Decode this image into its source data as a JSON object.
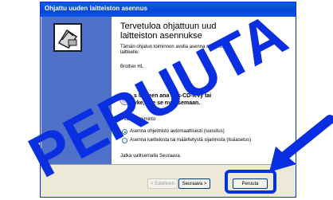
{
  "window": {
    "title": "Ohjattu uuden laitteiston asennus"
  },
  "wizard": {
    "heading_line1": "Tervetuloa ohjattuun uud",
    "heading_line2": "laitteiston asennukse",
    "intro_line1": "Tämän ohjatun toiminnon avulla asenna   ohjelmisto",
    "intro_line2": "laitteelle:",
    "device": "Brother HL",
    "cd_line1": "s laitteen    ana        nus-CD-levy tai",
    "cd_line2": "yke, ase    se nyt asemaan.",
    "question": "Valitse toiminto",
    "options": [
      {
        "label": "Asenna ohjelmisto automaattisesti (suositus)",
        "selected": true
      },
      {
        "label": "Asenna luettelosta tai määritetystä sijainnista (lisäasetus)",
        "selected": false
      }
    ],
    "continue_text": "Jatka valitsemalla Seuraava."
  },
  "buttons": {
    "back": "< Edellinen",
    "next": "Seuraava >",
    "cancel": "Peruuta"
  },
  "overlay": {
    "stamp_text": "PERUUTA",
    "color": "#0a2fe0"
  }
}
